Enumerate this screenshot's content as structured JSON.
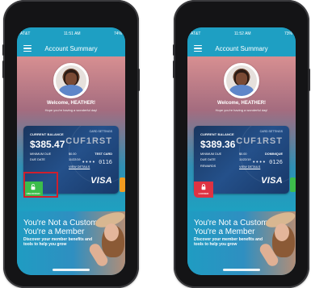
{
  "phones": [
    {
      "status": {
        "carrier": "AT&T",
        "time": "11:51 AM",
        "battery": "74%"
      },
      "header": {
        "title": "Account Summary"
      },
      "welcome": {
        "heading": "Welcome, HEATHER!",
        "subtext": "Hope you're having a wonderful day!"
      },
      "card": {
        "current_balance_label": "CURRENT BALANCE",
        "balance": "$385.47",
        "brand": "CUF1RST",
        "minimum_due_label": "MINIMUM DUE",
        "minimum_due": "$0.00",
        "due_date_label": "DUE DATE",
        "due_date": "11/22/19",
        "card_name": "TEST CARD",
        "card_number": "•••• 0116",
        "view_details": "VIEW DETAILS",
        "settings": "CARD SETTINGS",
        "network": "VISA"
      },
      "status_badge": {
        "label": "UNLOCKED"
      },
      "promo": {
        "line1": "You're Not a Customer,",
        "line2": "You're a Member",
        "body": "Discover your member benefits and tools to help you grow"
      }
    },
    {
      "status": {
        "carrier": "AT&T",
        "time": "11:52 AM",
        "battery": "73%"
      },
      "header": {
        "title": "Account Summary"
      },
      "welcome": {
        "heading": "Welcome, HEATHER!",
        "subtext": "Hope you're having a wonderful day!"
      },
      "card": {
        "current_balance_label": "CURRENT BALANCE",
        "balance": "$389.36",
        "brand": "CUF1RST",
        "minimum_due_label": "MINIMUM DUE",
        "minimum_due": "$0.00",
        "due_date_label": "DUE DATE",
        "due_date": "11/22/19",
        "rewards_label": "REWARDS",
        "card_name": "DOMINIQUE",
        "card_number": "•••• 0126",
        "view_details": "VIEW DETAILS",
        "settings": "CARD SETTINGS",
        "network": "VISA"
      },
      "status_badge": {
        "label": "LOCKED"
      },
      "promo": {
        "line1": "You're Not a Customer,",
        "line2": "You're a Member",
        "body": "Discover your member benefits and tools to help you grow"
      }
    }
  ],
  "colors": {
    "header": "#1e9fc3",
    "unlocked": "#3bbd4a",
    "locked": "#df3242",
    "highlight": "#cf1f2d"
  }
}
